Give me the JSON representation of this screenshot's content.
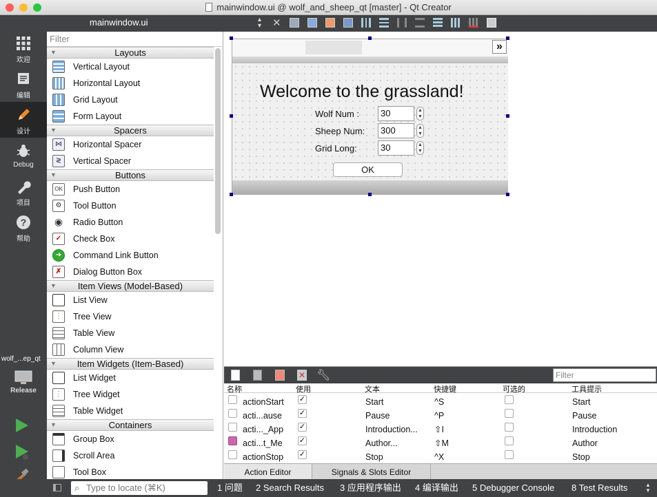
{
  "window": {
    "title": "mainwindow.ui @ wolf_and_sheep_qt [master] - Qt Creator"
  },
  "colors": {
    "sidebar": "#404244",
    "selection_handle": "#00008b",
    "close": "#fe5f57",
    "minimize": "#febc2e",
    "maximize": "#28c840"
  },
  "modes": [
    {
      "label": "欢迎",
      "icon": "grid-icon"
    },
    {
      "label": "编辑",
      "icon": "edit-icon"
    },
    {
      "label": "设计",
      "icon": "pencil-icon"
    },
    {
      "label": "Debug",
      "icon": "bug-icon"
    },
    {
      "label": "项目",
      "icon": "wrench-icon"
    },
    {
      "label": "帮助",
      "icon": "help-icon"
    }
  ],
  "project": {
    "name": "wolf_...ep_qt",
    "config": "Release"
  },
  "editor": {
    "file": "mainwindow.ui"
  },
  "widgetbox": {
    "filter_placeholder": "Filter",
    "categories": [
      {
        "name": "Layouts",
        "items": [
          "Vertical Layout",
          "Horizontal Layout",
          "Grid Layout",
          "Form Layout"
        ]
      },
      {
        "name": "Spacers",
        "items": [
          "Horizontal Spacer",
          "Vertical Spacer"
        ]
      },
      {
        "name": "Buttons",
        "items": [
          "Push Button",
          "Tool Button",
          "Radio Button",
          "Check Box",
          "Command Link Button",
          "Dialog Button Box"
        ]
      },
      {
        "name": "Item Views (Model-Based)",
        "items": [
          "List View",
          "Tree View",
          "Table View",
          "Column View"
        ]
      },
      {
        "name": "Item Widgets (Item-Based)",
        "items": [
          "List Widget",
          "Tree Widget",
          "Table Widget"
        ]
      },
      {
        "name": "Containers",
        "items": [
          "Group Box",
          "Scroll Area",
          "Tool Box"
        ]
      }
    ]
  },
  "form": {
    "overflow_button": "»",
    "welcome": "Welcome to the grassland!",
    "fields": [
      {
        "label": "Wolf Num :",
        "value": "30"
      },
      {
        "label": "Sheep Num:",
        "value": "300"
      },
      {
        "label": "Grid Long:",
        "value": "30"
      }
    ],
    "ok_label": "OK"
  },
  "action_editor": {
    "filter_placeholder": "Filter",
    "columns": [
      "名称",
      "使用",
      "文本",
      "快捷键",
      "可选的",
      "工具提示"
    ],
    "rows": [
      {
        "name": "actionStart",
        "used": "✓",
        "text": "Start",
        "shortcut": "^S",
        "tooltip": "Start"
      },
      {
        "name": "acti...ause",
        "used": "✓",
        "text": "Pause",
        "shortcut": "^P",
        "tooltip": "Pause"
      },
      {
        "name": "acti..._App",
        "used": "✓",
        "text": "Introduction...",
        "shortcut": "⇧I",
        "tooltip": "Introduction"
      },
      {
        "name": "acti...t_Me",
        "used": "✓",
        "text": "Author...",
        "shortcut": "⇧M",
        "tooltip": "Author"
      },
      {
        "name": "actionStop",
        "used": "✓",
        "text": "Stop",
        "shortcut": "^X",
        "tooltip": "Stop"
      }
    ],
    "tabs": [
      "Action Editor",
      "Signals & Slots Editor"
    ]
  },
  "statusbar": {
    "locate_placeholder": "Type to locate (⌘K)",
    "panes": [
      "1  问题",
      "2  Search Results",
      "3  应用程序输出",
      "4  编译输出",
      "5  Debugger Console",
      "8  Test Results"
    ]
  }
}
